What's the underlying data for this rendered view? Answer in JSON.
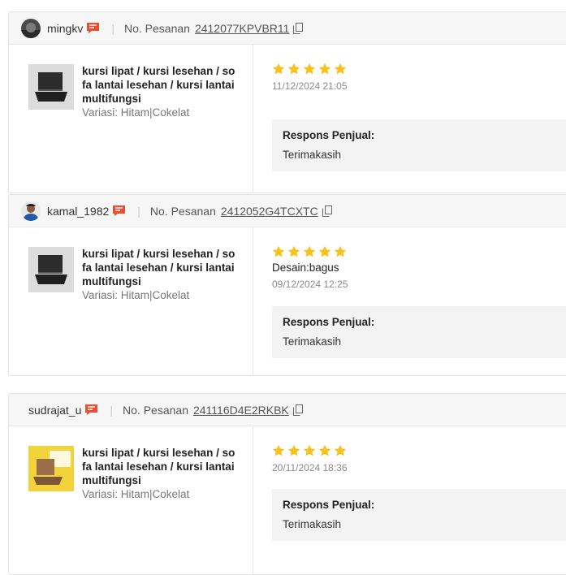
{
  "labels": {
    "order_label": "No. Pesanan",
    "response_label": "Respons Penjual:"
  },
  "colors": {
    "star": "#f8c21c",
    "chat_badge": "#ee4d2d",
    "response_bg": "#f3f3f3"
  },
  "reviews": [
    {
      "username": "mingkv",
      "order_no": "2412077KPVBR11",
      "product_name": "kursi lipat / kursi lesehan / so fa lantai lesehan / kursi lantai multifungsi",
      "variant": "Variasi: Hitam|Cokelat",
      "rating": 5,
      "comment": "",
      "date": "11/12/2024 21:05",
      "response": "Terimakasih"
    },
    {
      "username": "kamal_1982",
      "order_no": "2412052G4TCXTC",
      "product_name": "kursi lipat / kursi lesehan / so fa lantai lesehan / kursi lantai multifungsi",
      "variant": "Variasi: Hitam|Cokelat",
      "rating": 5,
      "comment": "Desain:bagus",
      "date": "09/12/2024 12:25",
      "response": "Terimakasih"
    },
    {
      "username": "sudrajat_u",
      "order_no": "241116D4E2RKBK",
      "product_name": "kursi lipat / kursi lesehan / so fa lantai lesehan / kursi lantai multifungsi",
      "variant": "Variasi: Hitam|Cokelat",
      "rating": 5,
      "comment": "",
      "date": "20/11/2024 18:36",
      "response": "Terimakasih"
    }
  ]
}
